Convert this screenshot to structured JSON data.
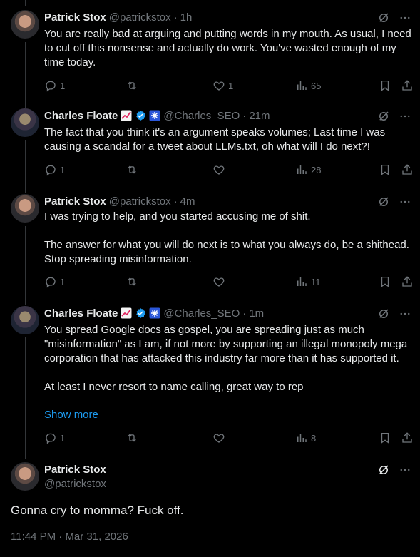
{
  "posts": [
    {
      "name": "Patrick Stox",
      "handle": "@patrickstox",
      "time": "1h",
      "text": "You are really bad at arguing and putting words in my mouth. As usual, I need to cut off this nonsense and actually do work. You've wasted enough of my time today.",
      "replies": "1",
      "reposts": "",
      "likes": "1",
      "views": "65"
    },
    {
      "name": "Charles Floate",
      "handle": "@Charles_SEO",
      "time": "21m",
      "text": "The fact that you think it's an argument speaks volumes; Last time I was causing a scandal for a tweet about LLMs.txt, oh what will I do next?!",
      "replies": "1",
      "reposts": "",
      "likes": "",
      "views": "28"
    },
    {
      "name": "Patrick Stox",
      "handle": "@patrickstox",
      "time": "4m",
      "text": "I was trying to help, and you started accusing me of shit.\n\nThe answer for what you will do next is to what you always do, be a shithead. Stop spreading misinformation.",
      "replies": "1",
      "reposts": "",
      "likes": "",
      "views": "11"
    },
    {
      "name": "Charles Floate",
      "handle": "@Charles_SEO",
      "time": "1m",
      "text": "You spread Google docs as gospel, you are spreading just as much \"misinformation\" as I am, if not more by supporting an illegal monopoly mega corporation that has attacked this industry far more than it has supported it.\n\nAt least I never resort to name calling, great way to rep",
      "show_more": "Show more",
      "replies": "1",
      "reposts": "",
      "likes": "",
      "views": "8"
    }
  ],
  "focused": {
    "name": "Patrick Stox",
    "handle": "@patrickstox",
    "text": "Gonna cry to momma? Fuck off.",
    "timestamp": "11:44 PM · Mar 31, 2026"
  },
  "colors": {
    "background": "#000000",
    "text": "#e7e9ea",
    "muted": "#71767b",
    "link": "#1d9bf0",
    "verified": "#1d9bf0"
  },
  "icons": [
    "grok-icon",
    "more-icon",
    "reply-icon",
    "repost-icon",
    "like-icon",
    "views-icon",
    "bookmark-icon",
    "share-icon",
    "verified-badge-icon",
    "chart-emoji-icon",
    "affiliate-badge-icon"
  ]
}
